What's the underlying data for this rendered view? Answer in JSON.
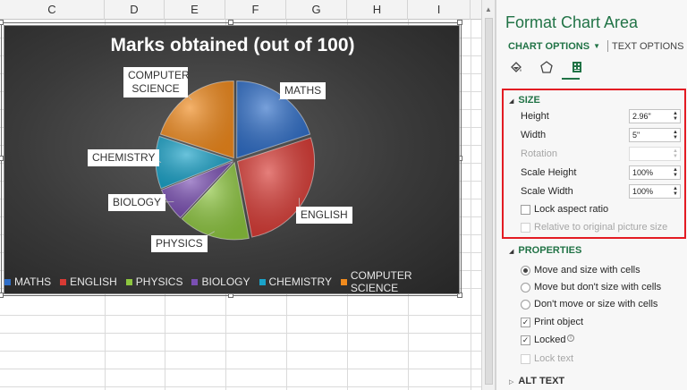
{
  "columns": [
    "C",
    "D",
    "E",
    "F",
    "G",
    "H",
    "I"
  ],
  "chart_data": {
    "type": "pie",
    "title": "Marks obtained (out of 100)",
    "categories": [
      "MATHS",
      "ENGLISH",
      "PHYSICS",
      "BIOLOGY",
      "CHEMISTRY",
      "COMPUTER SCIENCE"
    ],
    "values": [
      20,
      27,
      15,
      7,
      11,
      20
    ],
    "colors": [
      "#2f6ec8",
      "#d83a34",
      "#8dc63f",
      "#7a4fb3",
      "#1aa3c9",
      "#f08a1d"
    ],
    "legend_position": "bottom",
    "data_labels": [
      "MATHS",
      "ENGLISH",
      "PHYSICS",
      "BIOLOGY",
      "CHEMISTRY",
      "COMPUTER SCIENCE"
    ]
  },
  "pane": {
    "title": "Format Chart Area",
    "tab_chart_options": "CHART OPTIONS",
    "tab_text_options": "TEXT OPTIONS",
    "icons": [
      "fill-bucket-icon",
      "pentagon-icon",
      "size-properties-icon"
    ],
    "size": {
      "header": "SIZE",
      "height_label": "Height",
      "height_value": "2.96\"",
      "width_label": "Width",
      "width_value": "5\"",
      "rotation_label": "Rotation",
      "rotation_value": "",
      "scale_height_label": "Scale Height",
      "scale_height_value": "100%",
      "scale_width_label": "Scale Width",
      "scale_width_value": "100%",
      "lock_aspect_label": "Lock aspect ratio",
      "relative_label": "Relative to original picture size"
    },
    "properties": {
      "header": "PROPERTIES",
      "radio_move_size": "Move and size with cells",
      "radio_move_only": "Move but don't size with cells",
      "radio_none": "Don't move or size with cells",
      "print_object": "Print object",
      "locked": "Locked",
      "lock_text": "Lock text"
    },
    "alt_text": {
      "header": "ALT TEXT"
    }
  }
}
